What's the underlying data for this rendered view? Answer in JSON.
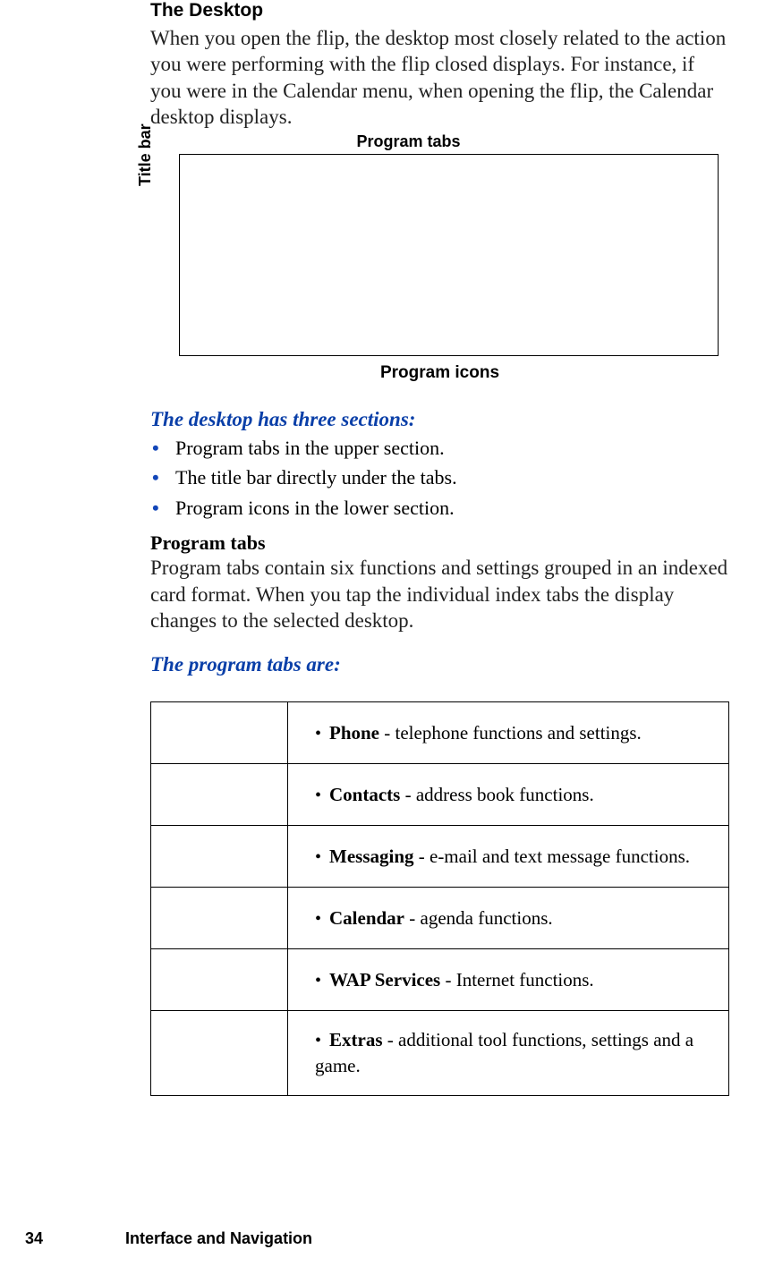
{
  "section_title": "The Desktop",
  "intro_paragraph": "When you open the flip, the desktop most closely related to the action you were performing with the flip closed displays. For instance, if you were in the Calendar menu, when opening the flip, the Calendar desktop displays.",
  "diagram": {
    "top_label": "Program tabs",
    "left_label": "Title bar",
    "bottom_label": "Program icons"
  },
  "subhead_sections": "The desktop has three sections:",
  "sections_list": [
    "Program tabs in the upper section.",
    "The title bar directly under the tabs.",
    "Program icons in the lower section."
  ],
  "program_tabs_heading": "Program tabs",
  "program_tabs_body": "Program tabs contain six functions and settings grouped in an indexed card format. When you tap the individual index tabs the display changes to the selected desktop.",
  "program_tabs_are": "The program tabs are:",
  "tabs_table": [
    {
      "name": "Phone",
      "desc": " - telephone functions and settings."
    },
    {
      "name": "Contacts",
      "desc": " - address book functions."
    },
    {
      "name": "Messaging",
      "desc": " - e-mail and text message functions."
    },
    {
      "name": "Calendar",
      "desc": " - agenda functions."
    },
    {
      "name": "WAP Services",
      "desc": " - Internet functions."
    },
    {
      "name": "Extras",
      "desc": " - additional tool functions, settings and a game."
    }
  ],
  "footer": {
    "page_number": "34",
    "chapter": "Interface and Navigation"
  }
}
